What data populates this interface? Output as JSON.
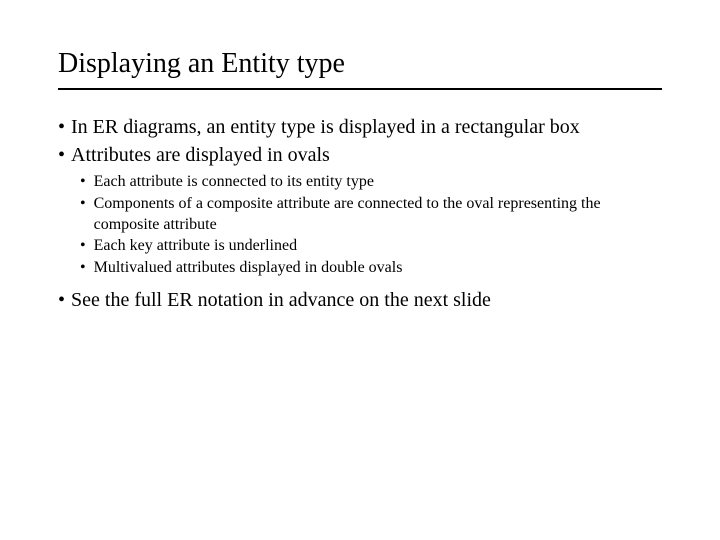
{
  "title": "Displaying an Entity type",
  "bullets": {
    "b1": "In ER diagrams, an entity type is displayed in a rectangular box",
    "b2": "Attributes are displayed in ovals",
    "b3": "See the full ER notation in advance on the next slide",
    "sub": {
      "s1": "Each attribute is connected to its entity type",
      "s2": "Components of a composite attribute are connected to the oval representing the composite attribute",
      "s3": "Each key attribute is underlined",
      "s4": "Multivalued attributes displayed in double ovals"
    }
  }
}
